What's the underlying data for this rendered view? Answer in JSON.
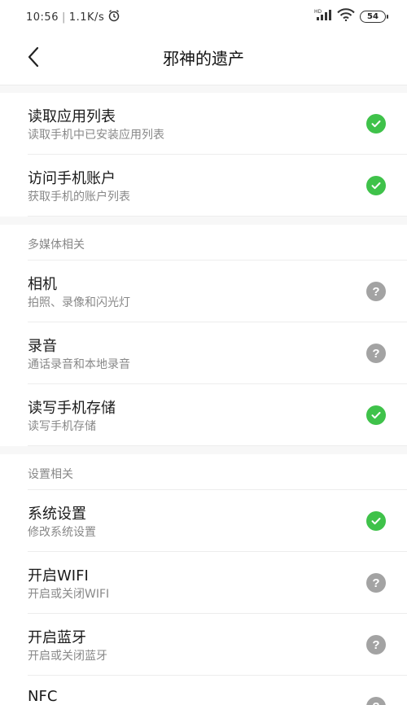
{
  "status_bar": {
    "time": "10:56",
    "speed": "1.1K/s",
    "battery": "54",
    "icons": [
      "alarm-icon",
      "signal-icon",
      "wifi-icon",
      "battery-icon"
    ]
  },
  "header": {
    "title": "邪神的遗产",
    "back_icon": "chevron-left-icon"
  },
  "colors": {
    "granted": "#3fc24a",
    "unknown": "#a3a3a3"
  },
  "sections": [
    {
      "header": "",
      "items": [
        {
          "title": "读取应用列表",
          "subtitle": "读取手机中已安装应用列表",
          "status": "granted"
        },
        {
          "title": "访问手机账户",
          "subtitle": "获取手机的账户列表",
          "status": "granted"
        }
      ]
    },
    {
      "header": "多媒体相关",
      "items": [
        {
          "title": "相机",
          "subtitle": "拍照、录像和闪光灯",
          "status": "unknown"
        },
        {
          "title": "录音",
          "subtitle": "通话录音和本地录音",
          "status": "unknown"
        },
        {
          "title": "读写手机存储",
          "subtitle": "读写手机存储",
          "status": "granted"
        }
      ]
    },
    {
      "header": "设置相关",
      "items": [
        {
          "title": "系统设置",
          "subtitle": "修改系统设置",
          "status": "granted"
        },
        {
          "title": "开启WIFI",
          "subtitle": "开启或关闭WIFI",
          "status": "unknown"
        },
        {
          "title": "开启蓝牙",
          "subtitle": "开启或关闭蓝牙",
          "status": "unknown"
        },
        {
          "title": "NFC",
          "subtitle": "",
          "status": "unknown"
        }
      ]
    }
  ]
}
